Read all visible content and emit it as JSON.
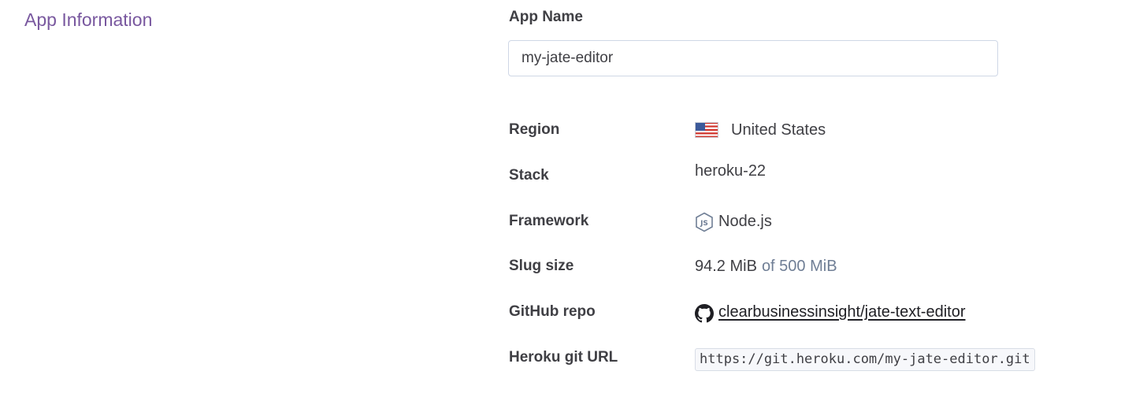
{
  "section": {
    "title": "App Information"
  },
  "app_name": {
    "label": "App Name",
    "value": "my-jate-editor"
  },
  "info": {
    "region": {
      "label": "Region",
      "value": "United States",
      "icon": "us-flag-icon"
    },
    "stack": {
      "label": "Stack",
      "value": "heroku-22"
    },
    "framework": {
      "label": "Framework",
      "value": "Node.js",
      "icon": "nodejs-icon"
    },
    "slug_size": {
      "label": "Slug size",
      "value": "94.2 MiB",
      "limit": "of 500 MiB"
    },
    "github_repo": {
      "label": "GitHub repo",
      "value": "clearbusinessinsight/jate-text-editor",
      "icon": "github-icon"
    },
    "git_url": {
      "label": "Heroku git URL",
      "value": "https://git.heroku.com/my-jate-editor.git"
    }
  },
  "colors": {
    "section_title": "#79589f",
    "text": "#3f3f44",
    "muted": "#6f7e95",
    "input_border": "#cfd7e6"
  }
}
